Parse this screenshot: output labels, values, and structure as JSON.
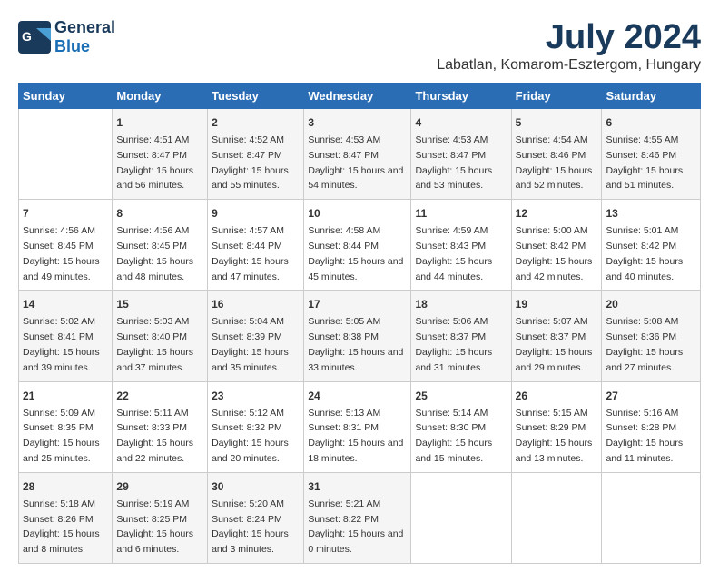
{
  "header": {
    "logo_line1": "General",
    "logo_line2": "Blue",
    "title": "July 2024",
    "subtitle": "Labatlan, Komarom-Esztergom, Hungary"
  },
  "weekdays": [
    "Sunday",
    "Monday",
    "Tuesday",
    "Wednesday",
    "Thursday",
    "Friday",
    "Saturday"
  ],
  "weeks": [
    [
      {
        "day": "",
        "sunrise": "",
        "sunset": "",
        "daylight": ""
      },
      {
        "day": "1",
        "sunrise": "Sunrise: 4:51 AM",
        "sunset": "Sunset: 8:47 PM",
        "daylight": "Daylight: 15 hours and 56 minutes."
      },
      {
        "day": "2",
        "sunrise": "Sunrise: 4:52 AM",
        "sunset": "Sunset: 8:47 PM",
        "daylight": "Daylight: 15 hours and 55 minutes."
      },
      {
        "day": "3",
        "sunrise": "Sunrise: 4:53 AM",
        "sunset": "Sunset: 8:47 PM",
        "daylight": "Daylight: 15 hours and 54 minutes."
      },
      {
        "day": "4",
        "sunrise": "Sunrise: 4:53 AM",
        "sunset": "Sunset: 8:47 PM",
        "daylight": "Daylight: 15 hours and 53 minutes."
      },
      {
        "day": "5",
        "sunrise": "Sunrise: 4:54 AM",
        "sunset": "Sunset: 8:46 PM",
        "daylight": "Daylight: 15 hours and 52 minutes."
      },
      {
        "day": "6",
        "sunrise": "Sunrise: 4:55 AM",
        "sunset": "Sunset: 8:46 PM",
        "daylight": "Daylight: 15 hours and 51 minutes."
      }
    ],
    [
      {
        "day": "7",
        "sunrise": "Sunrise: 4:56 AM",
        "sunset": "Sunset: 8:45 PM",
        "daylight": "Daylight: 15 hours and 49 minutes."
      },
      {
        "day": "8",
        "sunrise": "Sunrise: 4:56 AM",
        "sunset": "Sunset: 8:45 PM",
        "daylight": "Daylight: 15 hours and 48 minutes."
      },
      {
        "day": "9",
        "sunrise": "Sunrise: 4:57 AM",
        "sunset": "Sunset: 8:44 PM",
        "daylight": "Daylight: 15 hours and 47 minutes."
      },
      {
        "day": "10",
        "sunrise": "Sunrise: 4:58 AM",
        "sunset": "Sunset: 8:44 PM",
        "daylight": "Daylight: 15 hours and 45 minutes."
      },
      {
        "day": "11",
        "sunrise": "Sunrise: 4:59 AM",
        "sunset": "Sunset: 8:43 PM",
        "daylight": "Daylight: 15 hours and 44 minutes."
      },
      {
        "day": "12",
        "sunrise": "Sunrise: 5:00 AM",
        "sunset": "Sunset: 8:42 PM",
        "daylight": "Daylight: 15 hours and 42 minutes."
      },
      {
        "day": "13",
        "sunrise": "Sunrise: 5:01 AM",
        "sunset": "Sunset: 8:42 PM",
        "daylight": "Daylight: 15 hours and 40 minutes."
      }
    ],
    [
      {
        "day": "14",
        "sunrise": "Sunrise: 5:02 AM",
        "sunset": "Sunset: 8:41 PM",
        "daylight": "Daylight: 15 hours and 39 minutes."
      },
      {
        "day": "15",
        "sunrise": "Sunrise: 5:03 AM",
        "sunset": "Sunset: 8:40 PM",
        "daylight": "Daylight: 15 hours and 37 minutes."
      },
      {
        "day": "16",
        "sunrise": "Sunrise: 5:04 AM",
        "sunset": "Sunset: 8:39 PM",
        "daylight": "Daylight: 15 hours and 35 minutes."
      },
      {
        "day": "17",
        "sunrise": "Sunrise: 5:05 AM",
        "sunset": "Sunset: 8:38 PM",
        "daylight": "Daylight: 15 hours and 33 minutes."
      },
      {
        "day": "18",
        "sunrise": "Sunrise: 5:06 AM",
        "sunset": "Sunset: 8:37 PM",
        "daylight": "Daylight: 15 hours and 31 minutes."
      },
      {
        "day": "19",
        "sunrise": "Sunrise: 5:07 AM",
        "sunset": "Sunset: 8:37 PM",
        "daylight": "Daylight: 15 hours and 29 minutes."
      },
      {
        "day": "20",
        "sunrise": "Sunrise: 5:08 AM",
        "sunset": "Sunset: 8:36 PM",
        "daylight": "Daylight: 15 hours and 27 minutes."
      }
    ],
    [
      {
        "day": "21",
        "sunrise": "Sunrise: 5:09 AM",
        "sunset": "Sunset: 8:35 PM",
        "daylight": "Daylight: 15 hours and 25 minutes."
      },
      {
        "day": "22",
        "sunrise": "Sunrise: 5:11 AM",
        "sunset": "Sunset: 8:33 PM",
        "daylight": "Daylight: 15 hours and 22 minutes."
      },
      {
        "day": "23",
        "sunrise": "Sunrise: 5:12 AM",
        "sunset": "Sunset: 8:32 PM",
        "daylight": "Daylight: 15 hours and 20 minutes."
      },
      {
        "day": "24",
        "sunrise": "Sunrise: 5:13 AM",
        "sunset": "Sunset: 8:31 PM",
        "daylight": "Daylight: 15 hours and 18 minutes."
      },
      {
        "day": "25",
        "sunrise": "Sunrise: 5:14 AM",
        "sunset": "Sunset: 8:30 PM",
        "daylight": "Daylight: 15 hours and 15 minutes."
      },
      {
        "day": "26",
        "sunrise": "Sunrise: 5:15 AM",
        "sunset": "Sunset: 8:29 PM",
        "daylight": "Daylight: 15 hours and 13 minutes."
      },
      {
        "day": "27",
        "sunrise": "Sunrise: 5:16 AM",
        "sunset": "Sunset: 8:28 PM",
        "daylight": "Daylight: 15 hours and 11 minutes."
      }
    ],
    [
      {
        "day": "28",
        "sunrise": "Sunrise: 5:18 AM",
        "sunset": "Sunset: 8:26 PM",
        "daylight": "Daylight: 15 hours and 8 minutes."
      },
      {
        "day": "29",
        "sunrise": "Sunrise: 5:19 AM",
        "sunset": "Sunset: 8:25 PM",
        "daylight": "Daylight: 15 hours and 6 minutes."
      },
      {
        "day": "30",
        "sunrise": "Sunrise: 5:20 AM",
        "sunset": "Sunset: 8:24 PM",
        "daylight": "Daylight: 15 hours and 3 minutes."
      },
      {
        "day": "31",
        "sunrise": "Sunrise: 5:21 AM",
        "sunset": "Sunset: 8:22 PM",
        "daylight": "Daylight: 15 hours and 0 minutes."
      },
      {
        "day": "",
        "sunrise": "",
        "sunset": "",
        "daylight": ""
      },
      {
        "day": "",
        "sunrise": "",
        "sunset": "",
        "daylight": ""
      },
      {
        "day": "",
        "sunrise": "",
        "sunset": "",
        "daylight": ""
      }
    ]
  ]
}
